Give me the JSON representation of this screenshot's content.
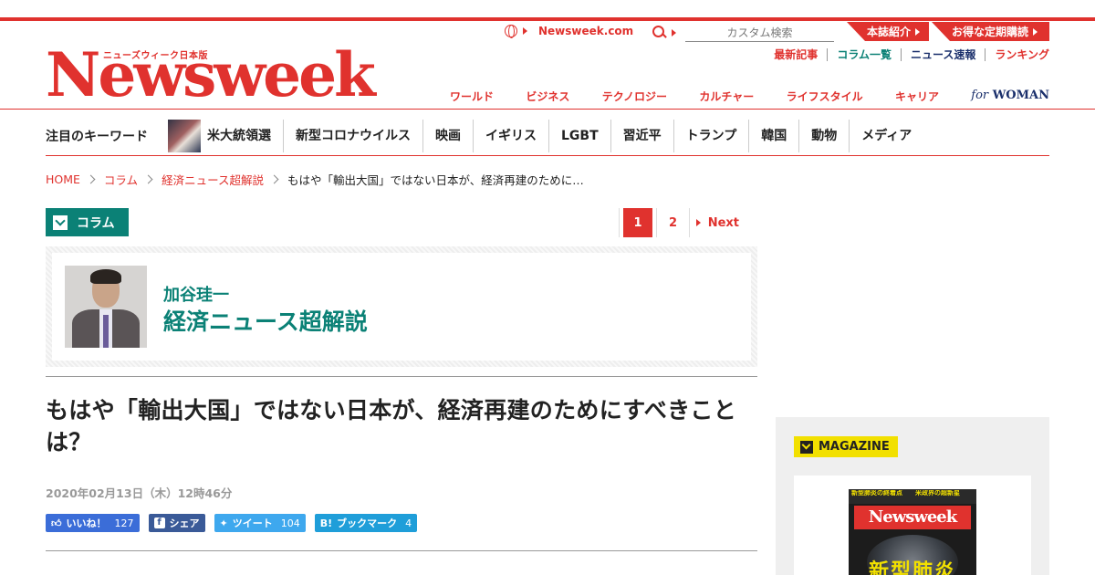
{
  "brand": {
    "logo_sub": "ニューズウィーク日本版",
    "logo_word": "Newsweek",
    "site_link": "Newsweek.com"
  },
  "search": {
    "placeholder": "カスタム検索"
  },
  "promos": {
    "about": "本誌紹介",
    "subscribe": "お得な定期購読"
  },
  "sub_links": [
    {
      "label": "最新記事",
      "color": "#e0322e"
    },
    {
      "label": "コラム一覧",
      "color": "#0b8176"
    },
    {
      "label": "ニュース速報",
      "color": "#1a2f6b"
    },
    {
      "label": "ランキング",
      "color": "#e0322e"
    }
  ],
  "categories": [
    "ワールド",
    "ビジネス",
    "テクノロジー",
    "カルチャー",
    "ライフスタイル",
    "キャリア"
  ],
  "for_woman": {
    "for": "for",
    "woman": "WOMAN"
  },
  "keywords": {
    "title": "注目のキーワード",
    "items": [
      "米大統領選",
      "新型コロナウイルス",
      "映画",
      "イギリス",
      "LGBT",
      "習近平",
      "トランプ",
      "韓国",
      "動物",
      "メディア"
    ]
  },
  "breadcrumb": [
    "HOME",
    "コラム",
    "経済ニュース超解説",
    "もはや「輸出大国」ではない日本が、経済再建のために…"
  ],
  "column_tag": "コラム",
  "pager": {
    "pages": [
      "1",
      "2"
    ],
    "current": "1",
    "next": "Next"
  },
  "author": {
    "name": "加谷珪一",
    "column": "経済ニュース超解説"
  },
  "article": {
    "headline": "もはや「輸出大国」ではない日本が、経済再建のためにすべきことは？",
    "date": "2020年02月13日（木）12時46分"
  },
  "share": {
    "like": {
      "label": "いいね！",
      "count": "127"
    },
    "fb_share": {
      "label": "シェア"
    },
    "tweet": {
      "label": "ツイート",
      "count": "104"
    },
    "bookmark": {
      "label": "ブックマーク",
      "count": "4"
    }
  },
  "sidebar": {
    "magazine_label": "MAGAZINE",
    "cover": {
      "top_left": "新型肺炎の終着点",
      "top_right": "米政界の超新星",
      "logo": "Newsweek",
      "headline": "新型肺炎"
    }
  },
  "colors": {
    "brand_red": "#e0322e",
    "column_green": "#0b8176",
    "navy": "#1a2f6b",
    "magazine_yellow": "#f2e000"
  }
}
